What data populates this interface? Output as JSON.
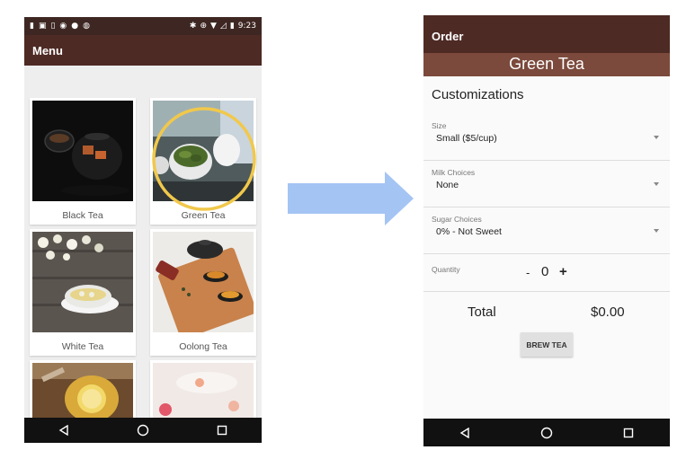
{
  "left_screen": {
    "status_bar": {
      "notification_icons": [
        "app-icon",
        "gallery-icon",
        "phone-icon",
        "sync-icon",
        "sync-icon",
        "sync-icon"
      ],
      "system_icons": [
        "bluetooth-icon",
        "vibrate-icon",
        "wifi-icon",
        "signal-icon",
        "battery-icon"
      ],
      "time": "9:23"
    },
    "app_bar_title": "Menu",
    "menu_items": [
      {
        "label": "Black Tea"
      },
      {
        "label": "Green Tea"
      },
      {
        "label": "White Tea"
      },
      {
        "label": "Oolong Tea"
      }
    ],
    "highlight_color": "#f1c84b"
  },
  "arrow_color": "#a4c4f4",
  "right_screen": {
    "app_bar_title": "Order",
    "tea_name": "Green Tea",
    "section_title": "Customizations",
    "size": {
      "label": "Size",
      "value": "Small ($5/cup)"
    },
    "milk": {
      "label": "Milk Choices",
      "value": "None"
    },
    "sugar": {
      "label": "Sugar Choices",
      "value": "0% - Not Sweet"
    },
    "quantity": {
      "label": "Quantity",
      "minus": "-",
      "value": "0",
      "plus": "+"
    },
    "total": {
      "label": "Total",
      "value": "$0.00"
    },
    "brew_button": "BREW TEA"
  },
  "colors": {
    "app_bar": "#4e2a24",
    "subheader": "#7b4a3c",
    "status_bar": "#3e2723"
  }
}
